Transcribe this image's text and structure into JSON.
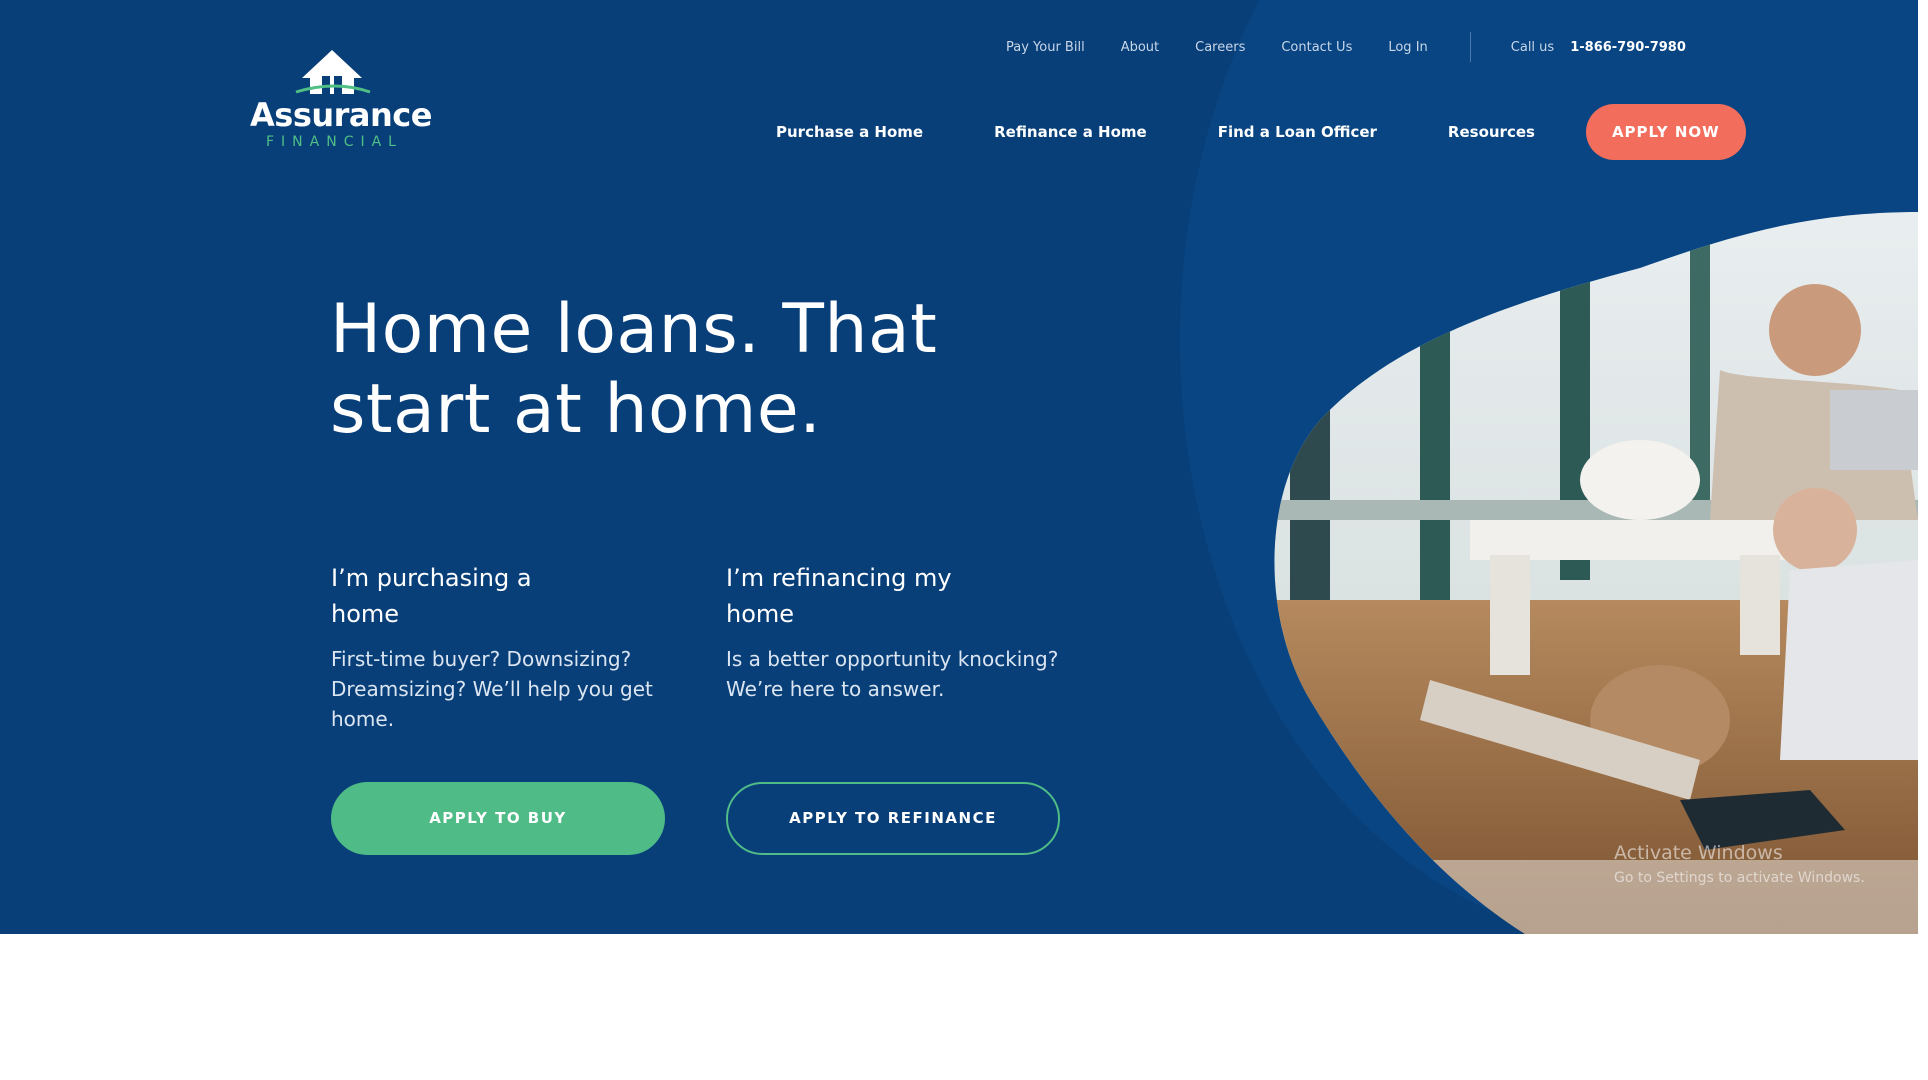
{
  "brand": {
    "name": "Assurance",
    "sub": "FINANCIAL",
    "colors": {
      "primary": "#083f79",
      "accent_coral": "#f26d5b",
      "accent_green": "#4fbb86"
    }
  },
  "util_nav": {
    "items": [
      "Pay Your Bill",
      "About",
      "Careers",
      "Contact Us",
      "Log In"
    ],
    "call_label": "Call us",
    "phone": "1-866-790-7980"
  },
  "main_nav": {
    "items": [
      "Purchase a Home",
      "Refinance a Home",
      "Find a Loan Officer",
      "Resources"
    ],
    "cta": "APPLY NOW"
  },
  "hero": {
    "headline_line1": "Home loans. That",
    "headline_line2": "start at home.",
    "purchase": {
      "title": "I’m purchasing a home",
      "body": "First-time buyer? Downsizing? Dreamsizing? We’ll help you get home.",
      "button": "APPLY TO BUY"
    },
    "refinance": {
      "title": "I’m refinancing my home",
      "body": "Is a better opportunity knocking? We’re here to answer.",
      "button": "APPLY TO REFINANCE"
    }
  },
  "watermark": {
    "line1": "Activate Windows",
    "line2": "Go to Settings to activate Windows."
  }
}
